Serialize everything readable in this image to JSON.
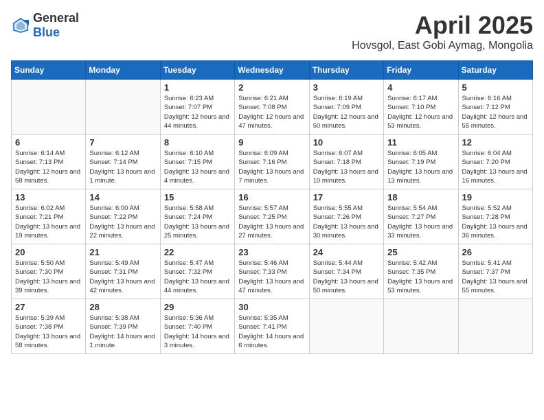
{
  "header": {
    "logo_general": "General",
    "logo_blue": "Blue",
    "month": "April 2025",
    "location": "Hovsgol, East Gobi Aymag, Mongolia"
  },
  "days_of_week": [
    "Sunday",
    "Monday",
    "Tuesday",
    "Wednesday",
    "Thursday",
    "Friday",
    "Saturday"
  ],
  "weeks": [
    [
      {
        "day": "",
        "info": ""
      },
      {
        "day": "",
        "info": ""
      },
      {
        "day": "1",
        "info": "Sunrise: 6:23 AM\nSunset: 7:07 PM\nDaylight: 12 hours and 44 minutes."
      },
      {
        "day": "2",
        "info": "Sunrise: 6:21 AM\nSunset: 7:08 PM\nDaylight: 12 hours and 47 minutes."
      },
      {
        "day": "3",
        "info": "Sunrise: 6:19 AM\nSunset: 7:09 PM\nDaylight: 12 hours and 50 minutes."
      },
      {
        "day": "4",
        "info": "Sunrise: 6:17 AM\nSunset: 7:10 PM\nDaylight: 12 hours and 53 minutes."
      },
      {
        "day": "5",
        "info": "Sunrise: 6:16 AM\nSunset: 7:12 PM\nDaylight: 12 hours and 55 minutes."
      }
    ],
    [
      {
        "day": "6",
        "info": "Sunrise: 6:14 AM\nSunset: 7:13 PM\nDaylight: 12 hours and 58 minutes."
      },
      {
        "day": "7",
        "info": "Sunrise: 6:12 AM\nSunset: 7:14 PM\nDaylight: 13 hours and 1 minute."
      },
      {
        "day": "8",
        "info": "Sunrise: 6:10 AM\nSunset: 7:15 PM\nDaylight: 13 hours and 4 minutes."
      },
      {
        "day": "9",
        "info": "Sunrise: 6:09 AM\nSunset: 7:16 PM\nDaylight: 13 hours and 7 minutes."
      },
      {
        "day": "10",
        "info": "Sunrise: 6:07 AM\nSunset: 7:18 PM\nDaylight: 13 hours and 10 minutes."
      },
      {
        "day": "11",
        "info": "Sunrise: 6:05 AM\nSunset: 7:19 PM\nDaylight: 13 hours and 13 minutes."
      },
      {
        "day": "12",
        "info": "Sunrise: 6:04 AM\nSunset: 7:20 PM\nDaylight: 13 hours and 16 minutes."
      }
    ],
    [
      {
        "day": "13",
        "info": "Sunrise: 6:02 AM\nSunset: 7:21 PM\nDaylight: 13 hours and 19 minutes."
      },
      {
        "day": "14",
        "info": "Sunrise: 6:00 AM\nSunset: 7:22 PM\nDaylight: 13 hours and 22 minutes."
      },
      {
        "day": "15",
        "info": "Sunrise: 5:58 AM\nSunset: 7:24 PM\nDaylight: 13 hours and 25 minutes."
      },
      {
        "day": "16",
        "info": "Sunrise: 5:57 AM\nSunset: 7:25 PM\nDaylight: 13 hours and 27 minutes."
      },
      {
        "day": "17",
        "info": "Sunrise: 5:55 AM\nSunset: 7:26 PM\nDaylight: 13 hours and 30 minutes."
      },
      {
        "day": "18",
        "info": "Sunrise: 5:54 AM\nSunset: 7:27 PM\nDaylight: 13 hours and 33 minutes."
      },
      {
        "day": "19",
        "info": "Sunrise: 5:52 AM\nSunset: 7:28 PM\nDaylight: 13 hours and 36 minutes."
      }
    ],
    [
      {
        "day": "20",
        "info": "Sunrise: 5:50 AM\nSunset: 7:30 PM\nDaylight: 13 hours and 39 minutes."
      },
      {
        "day": "21",
        "info": "Sunrise: 5:49 AM\nSunset: 7:31 PM\nDaylight: 13 hours and 42 minutes."
      },
      {
        "day": "22",
        "info": "Sunrise: 5:47 AM\nSunset: 7:32 PM\nDaylight: 13 hours and 44 minutes."
      },
      {
        "day": "23",
        "info": "Sunrise: 5:46 AM\nSunset: 7:33 PM\nDaylight: 13 hours and 47 minutes."
      },
      {
        "day": "24",
        "info": "Sunrise: 5:44 AM\nSunset: 7:34 PM\nDaylight: 13 hours and 50 minutes."
      },
      {
        "day": "25",
        "info": "Sunrise: 5:42 AM\nSunset: 7:35 PM\nDaylight: 13 hours and 53 minutes."
      },
      {
        "day": "26",
        "info": "Sunrise: 5:41 AM\nSunset: 7:37 PM\nDaylight: 13 hours and 55 minutes."
      }
    ],
    [
      {
        "day": "27",
        "info": "Sunrise: 5:39 AM\nSunset: 7:38 PM\nDaylight: 13 hours and 58 minutes."
      },
      {
        "day": "28",
        "info": "Sunrise: 5:38 AM\nSunset: 7:39 PM\nDaylight: 14 hours and 1 minute."
      },
      {
        "day": "29",
        "info": "Sunrise: 5:36 AM\nSunset: 7:40 PM\nDaylight: 14 hours and 3 minutes."
      },
      {
        "day": "30",
        "info": "Sunrise: 5:35 AM\nSunset: 7:41 PM\nDaylight: 14 hours and 6 minutes."
      },
      {
        "day": "",
        "info": ""
      },
      {
        "day": "",
        "info": ""
      },
      {
        "day": "",
        "info": ""
      }
    ]
  ]
}
